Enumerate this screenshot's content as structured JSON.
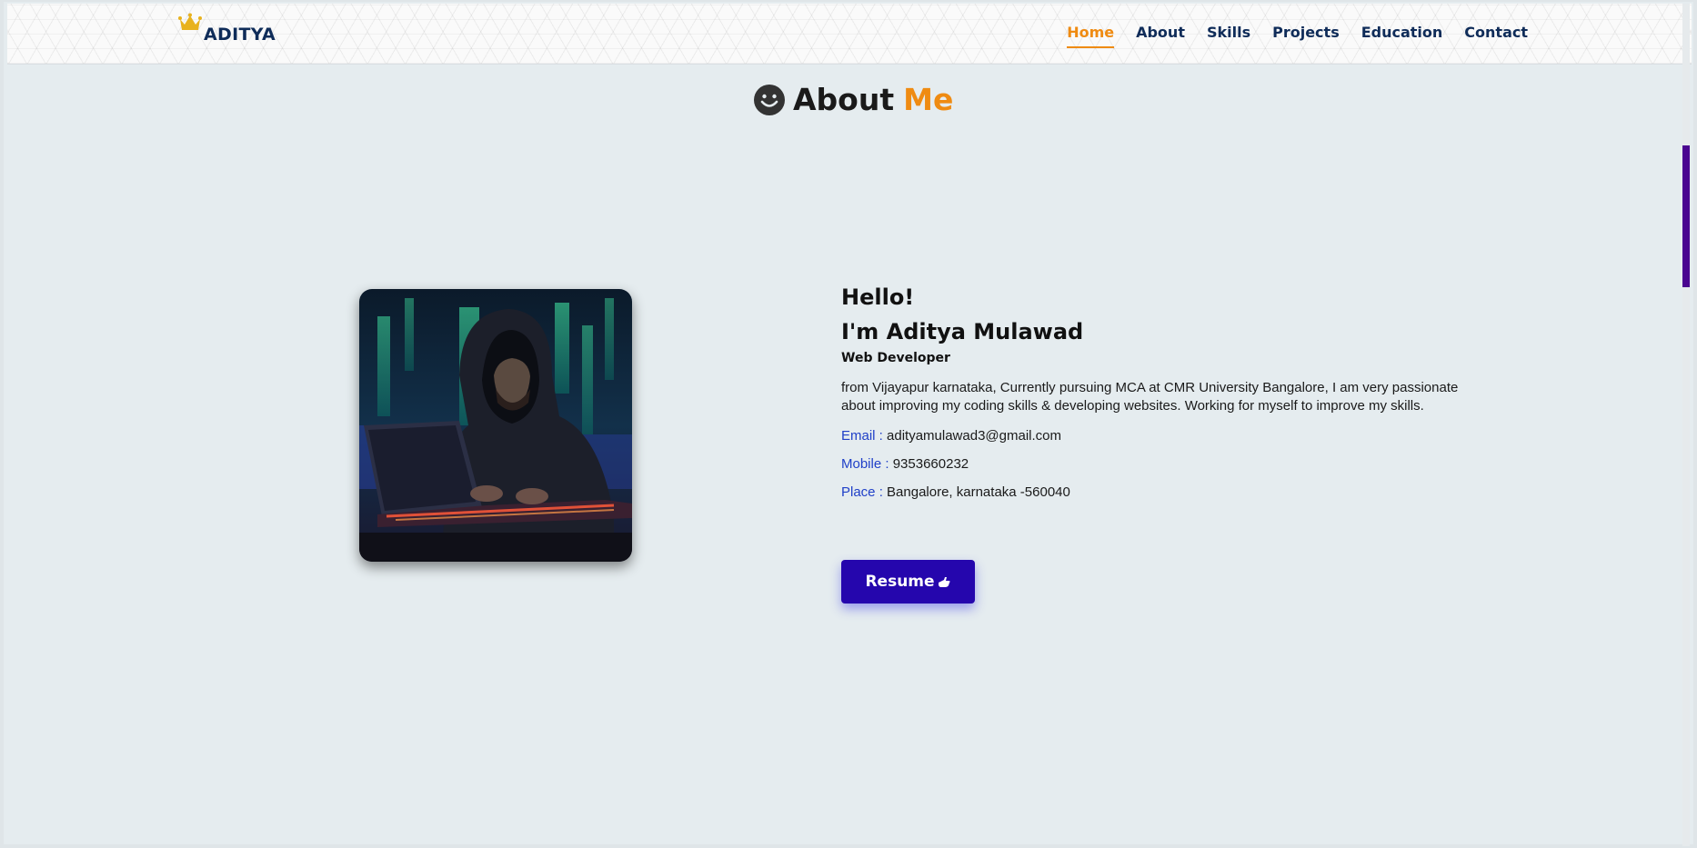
{
  "brand": {
    "name": "ADITYA",
    "icon": "crown-icon"
  },
  "nav": {
    "items": [
      {
        "label": "Home",
        "active": true
      },
      {
        "label": "About",
        "active": false
      },
      {
        "label": "Skills",
        "active": false
      },
      {
        "label": "Projects",
        "active": false
      },
      {
        "label": "Education",
        "active": false
      },
      {
        "label": "Contact",
        "active": false
      }
    ]
  },
  "about": {
    "title_part1": "About",
    "title_part2": "Me",
    "title_icon": "smile-icon",
    "hello": "Hello!",
    "name": "I'm Aditya Mulawad",
    "role": "Web Developer",
    "description": "from Vijayapur karnataka, Currently pursuing MCA at CMR University Bangalore, I am very passionate about improving my coding skills & developing websites. Working for myself to improve my skills.",
    "email_label": "Email :",
    "email": "adityamulawad3@gmail.com",
    "mobile_label": "Mobile :",
    "mobile": "9353660232",
    "place_label": "Place :",
    "place": "Bangalore, karnataka -560040",
    "resume_label": "Resume",
    "resume_icon": "hand-pointer-icon",
    "photo_icon": "hacker-laptop-image"
  },
  "colors": {
    "accent": "#ef8b12",
    "brand": "#0f2c59",
    "button": "#2506ad",
    "label": "#2040c8",
    "scroll_thumb": "#4a0590"
  }
}
